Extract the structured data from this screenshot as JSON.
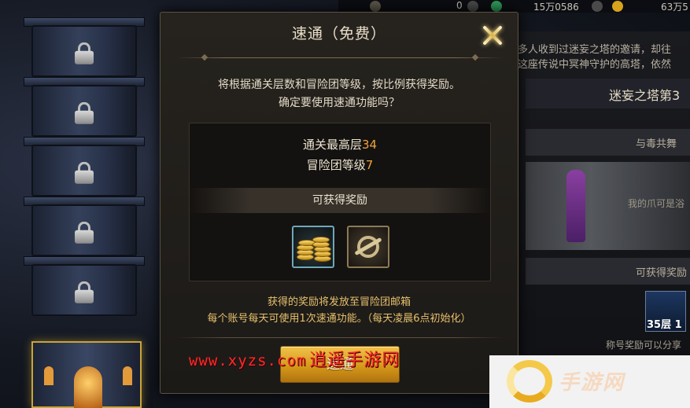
{
  "topbar": {
    "value_1": "0",
    "value_2": "15万0586",
    "value_3": "63万5"
  },
  "right_panel": {
    "intro_line1": "多人收到过迷妄之塔的邀请，却往",
    "intro_line2": "这座传说中冥神守护的高塔，依然",
    "tower_title": "迷妄之塔第3",
    "stage_name": "与毒共舞",
    "quote": "我的爪可是浴",
    "reward_header": "可获得奖励",
    "item_label": "35层 1",
    "note": "称号奖励可以分享"
  },
  "dialog": {
    "title": "速通（免费）",
    "desc_line1": "将根据通关层数和冒险团等级，按比例获得奖励。",
    "desc_line2": "确定要使用速通功能吗？",
    "max_floor_label": "通关最高层",
    "max_floor_value": "34",
    "guild_level_label": "冒险团等级",
    "guild_level_value": "7",
    "reward_title": "可获得奖励",
    "rewards": [
      {
        "icon": "gold-coins-icon"
      },
      {
        "icon": "emblem-icon"
      }
    ],
    "note_line1": "获得的奖励将发放至冒险团邮箱",
    "note_line2": "每个账号每天可使用1次速通功能。（每天凌晨6点初始化）",
    "confirm_label": "速通"
  },
  "watermark": {
    "url": "www.xyzs.com",
    "name": "逍遥手游网"
  },
  "colors": {
    "accent_orange": "#f2a23c",
    "button_gold": "#d69a1a",
    "watermark_red": "#ff2a2a"
  }
}
